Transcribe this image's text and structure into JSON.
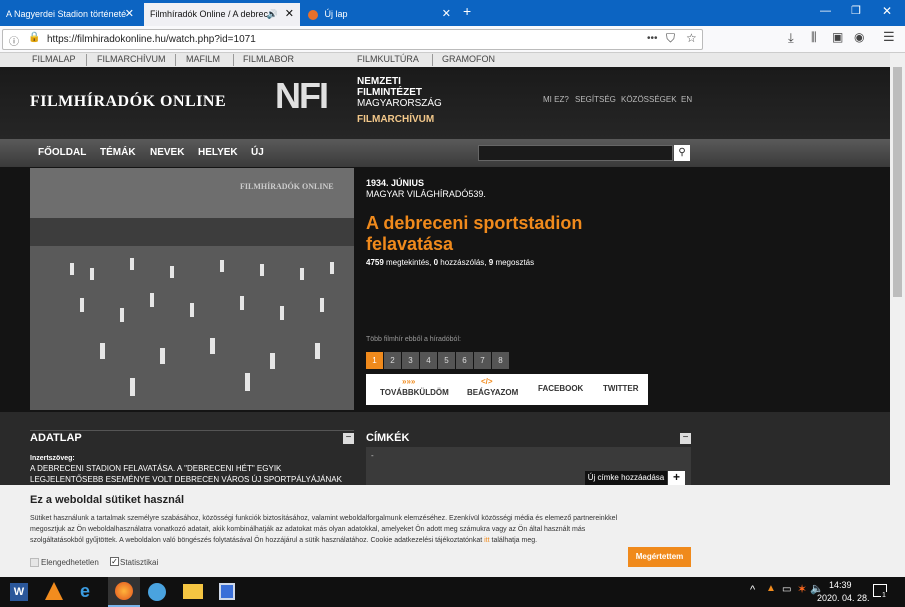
{
  "browser": {
    "tabs": [
      {
        "label": "A Nagyerdei Stadion történeté",
        "active": false
      },
      {
        "label": "Filmhíradók Online / A debrece",
        "active": true
      },
      {
        "label": "Új lap",
        "active": false
      }
    ],
    "url": "https://filmhiradokonline.hu/watch.php?id=1071",
    "url_dots": "•••"
  },
  "site": {
    "topnav": [
      "FILMALAP",
      "FILMARCHÍVUM",
      "MAFILM",
      "FILMLABOR",
      "FILMKULTÚRA",
      "GRAMOFON"
    ],
    "logo": "FILMHÍRADÓK ONLINE",
    "nfi_mark": "NFI",
    "nfi_lines": [
      "NEMZETI",
      "FILMINTÉZET",
      "MAGYARORSZÁG"
    ],
    "nfi_archive": "FILMARCHÍVUM",
    "header_links": [
      "MI EZ?",
      "SEGÍTSÉG",
      "KÖZÖSSÉGEK",
      "EN"
    ],
    "menu": [
      "FŐOLDAL",
      "TÉMÁK",
      "NEVEK",
      "HELYEK",
      "ÚJ"
    ],
    "search_placeholder": ""
  },
  "video": {
    "watermark": "FILMHÍRADÓK ONLINE",
    "date": "1934. JÚNIUS",
    "series": "MAGYAR VILÁGHÍRADÓ539.",
    "title_line1": "A debreceni sportstadion",
    "title_line2": "felavatása",
    "stats": {
      "views": "4759",
      "views_label": " megtekintés, ",
      "comments": "0",
      "comments_label": " hozzászólás, ",
      "shares": "9",
      "shares_label": " megosztás"
    },
    "more_label": "Több filmhír ebből a híradóból:",
    "pages": [
      "1",
      "2",
      "3",
      "4",
      "5",
      "6",
      "7",
      "8"
    ],
    "share": [
      "TOVÁBBKÜLDÖM",
      "BEÁGYAZOM",
      "FACEBOOK",
      "TWITTER"
    ]
  },
  "adatlap": {
    "title": "ADATLAP",
    "intertitle_label": "Inzertszöveg:",
    "line1": "A DEBRECENI STADION FELAVATÁSA. A \"DEBRECENI HÉT\" EGYIK",
    "line2": "LEGJELENTŐSEBB ESEMÉNYE VOLT DEBRECEN VÁROS ÚJ SPORTPÁLYÁJÁNAK"
  },
  "cimkek": {
    "title": "CÍMKÉK",
    "dash": "-",
    "add_label": "Új címke hozzáadása"
  },
  "cookie": {
    "title": "Ez a weboldal sütiket használ",
    "line1": "Sütiket használunk a tartalmak személyre szabásához, közösségi funkciók biztosításához, valamint weboldalforgalmunk elemzéséhez. Ezenkívül közösségi média és elemező partnereinkkel",
    "line2": "megosztjuk az Ön weboldalhasználatra vonatkozó adatait, akik kombinálhatják az adatokat más olyan adatokkal, amelyeket Ön adott meg számukra vagy az Ön által használt más",
    "line3a": "szolgáltatásokból gyűjtöttek. A weboldalon való böngészés folytatásával Ön hozzájárul a sütik használatához. Cookie adatkezelési tájékoztatónkat ",
    "line3_link": "itt",
    "line3b": " találhatja meg.",
    "check1": "Elengedhetetlen",
    "check2": "Statisztikai",
    "accept": "Megértettem"
  },
  "taskbar": {
    "time": "14:39",
    "date": "2020. 04. 28.",
    "notif_count": "1"
  },
  "colors": {
    "accent": "#f08a1c",
    "tabbar": "#0c64c2"
  }
}
